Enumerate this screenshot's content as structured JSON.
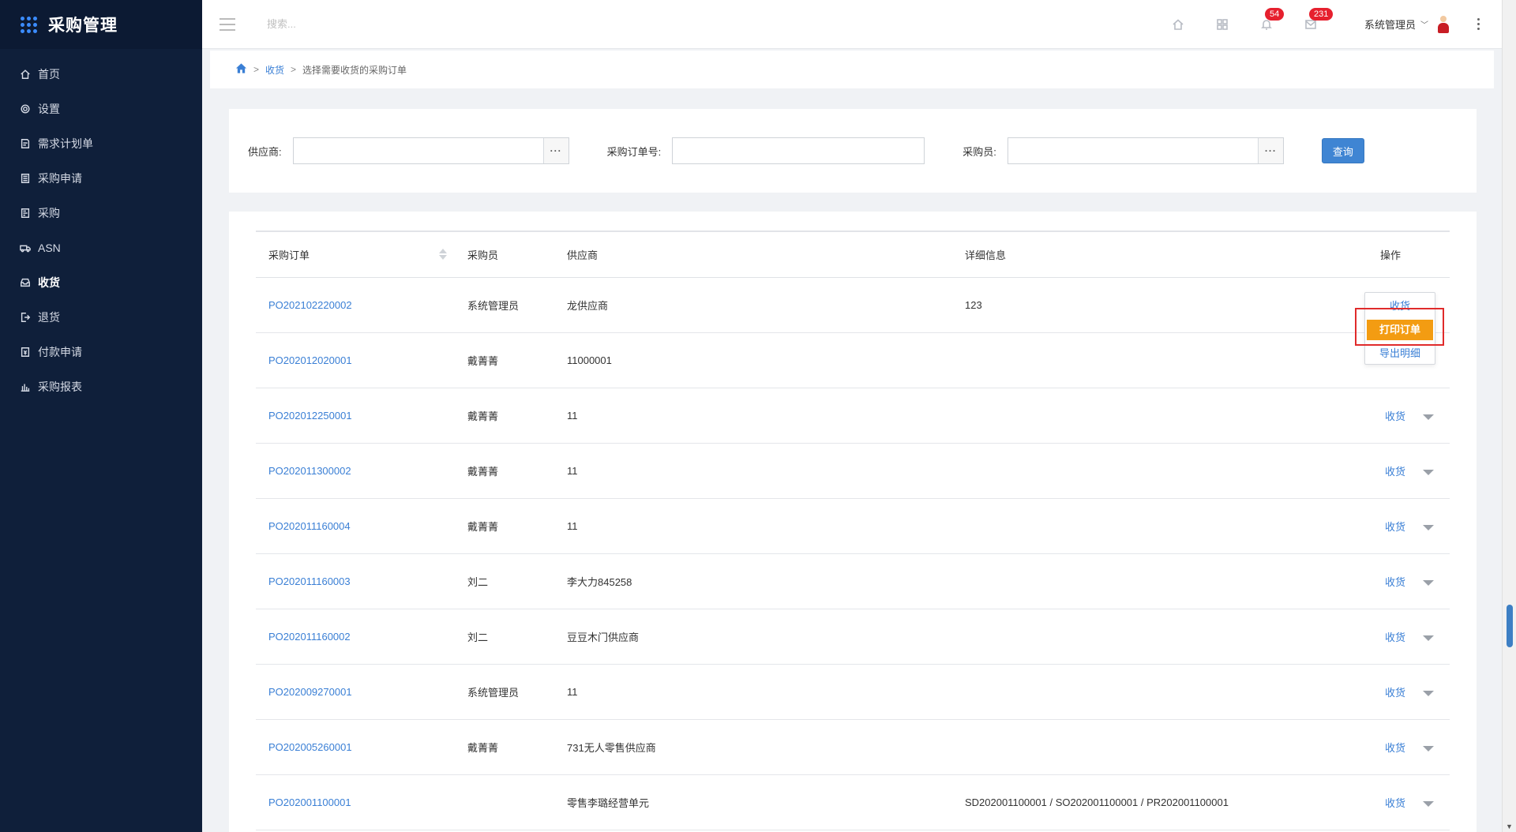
{
  "app": {
    "title": "采购管理"
  },
  "sidebar": {
    "items": [
      {
        "label": "首页",
        "icon": "home-icon"
      },
      {
        "label": "设置",
        "icon": "gear-icon"
      },
      {
        "label": "需求计划单",
        "icon": "document-icon"
      },
      {
        "label": "采购申请",
        "icon": "clipboard-icon"
      },
      {
        "label": "采购",
        "icon": "list-icon"
      },
      {
        "label": "ASN",
        "icon": "truck-icon"
      },
      {
        "label": "收货",
        "icon": "inbox-icon",
        "active": true
      },
      {
        "label": "退货",
        "icon": "exit-icon"
      },
      {
        "label": "付款申请",
        "icon": "payment-icon"
      },
      {
        "label": "采购报表",
        "icon": "bar-chart-icon"
      }
    ]
  },
  "header": {
    "search_placeholder": "搜索...",
    "notifications_count": "54",
    "messages_count": "231",
    "user_name": "系统管理员"
  },
  "breadcrumb": {
    "items": [
      "收货",
      "选择需要收货的采购订单"
    ]
  },
  "filter": {
    "supplier_label": "供应商:",
    "order_label": "采购订单号:",
    "buyer_label": "采购员:",
    "dots": "···",
    "query_button": "查询"
  },
  "table": {
    "headers": [
      "采购订单",
      "采购员",
      "供应商",
      "详细信息",
      "操作"
    ],
    "rows": [
      {
        "po": "PO202102220002",
        "buyer": "系统管理员",
        "supplier": "龙供应商",
        "detail": "123"
      },
      {
        "po": "PO202012020001",
        "buyer": "戴菁菁",
        "supplier": "11000001",
        "detail": ""
      },
      {
        "po": "PO202012250001",
        "buyer": "戴菁菁",
        "supplier": "11",
        "detail": ""
      },
      {
        "po": "PO202011300002",
        "buyer": "戴菁菁",
        "supplier": "11",
        "detail": ""
      },
      {
        "po": "PO202011160004",
        "buyer": "戴菁菁",
        "supplier": "11",
        "detail": ""
      },
      {
        "po": "PO202011160003",
        "buyer": "刘二",
        "supplier": "李大力845258",
        "detail": ""
      },
      {
        "po": "PO202011160002",
        "buyer": "刘二",
        "supplier": "豆豆木门供应商",
        "detail": ""
      },
      {
        "po": "PO202009270001",
        "buyer": "系统管理员",
        "supplier": "11",
        "detail": ""
      },
      {
        "po": "PO202005260001",
        "buyer": "戴菁菁",
        "supplier": "731无人零售供应商",
        "detail": ""
      },
      {
        "po": "PO202001100001",
        "buyer": "",
        "supplier": "零售李璐经营单元",
        "detail": "SD202001100001 / SO202001100001 / PR202001100001"
      }
    ],
    "action_label": "收货"
  },
  "dropdown": {
    "items": [
      "收货",
      "打印订单",
      "导出明细"
    ]
  },
  "colors": {
    "sidebar_bg": "#0f1f3a",
    "link": "#3a7fd5",
    "primary_button": "#3f85d3",
    "highlight_item": "#f39c12",
    "badge": "#e6202e",
    "annotation_box": "#e02b2b"
  }
}
